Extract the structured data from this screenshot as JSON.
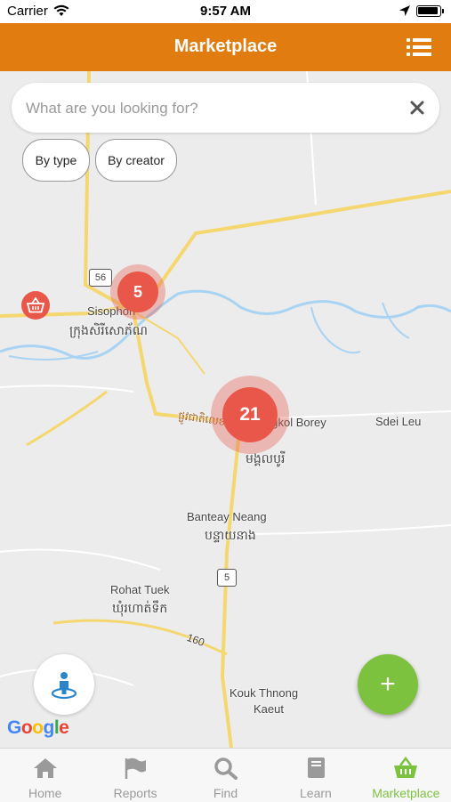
{
  "status_bar": {
    "carrier": "Carrier",
    "time": "9:57 AM"
  },
  "header": {
    "title": "Marketplace",
    "menu_icon": "list-icon"
  },
  "search": {
    "placeholder": "What are you looking for?",
    "value": ""
  },
  "filters": [
    {
      "label": "By type"
    },
    {
      "label": "By creator"
    }
  ],
  "map": {
    "places": [
      {
        "name": "Sisophon"
      },
      {
        "name": "ក្រុងសិរីសោភ័ណ"
      },
      {
        "name": "Sdei Leu"
      },
      {
        "name": "Banteay Neang"
      },
      {
        "name": "បន្ទាយនាង"
      },
      {
        "name": "Rohat Tuek"
      },
      {
        "name": "ឃុំរហាត់ទឹក"
      },
      {
        "name": "Kouk Thnong"
      },
      {
        "name": "Kaeut"
      },
      {
        "name": "Mongkol Borey"
      },
      {
        "name": "មង្គលបូរី"
      },
      {
        "name": "ផ្លូវជាតិលេខ៥"
      }
    ],
    "road_shields": [
      "56",
      "5",
      "160"
    ],
    "clusters": [
      {
        "count": "5"
      },
      {
        "count": "21"
      }
    ],
    "attribution": "Google",
    "colors": {
      "cluster": "#e8574a",
      "road": "#f5d770",
      "river": "#a9d3f2",
      "background": "#ececec"
    }
  },
  "fab_label": "+",
  "tabs": [
    {
      "label": "Home",
      "icon": "home-icon",
      "active": false
    },
    {
      "label": "Reports",
      "icon": "flag-icon",
      "active": false
    },
    {
      "label": "Find",
      "icon": "search-icon",
      "active": false
    },
    {
      "label": "Learn",
      "icon": "book-icon",
      "active": false
    },
    {
      "label": "Marketplace",
      "icon": "basket-icon",
      "active": true
    }
  ],
  "colors": {
    "accent": "#e07c10",
    "active_tab": "#7dc23f",
    "inactive_tab": "#9a9a9a",
    "fab": "#7dc23f"
  }
}
